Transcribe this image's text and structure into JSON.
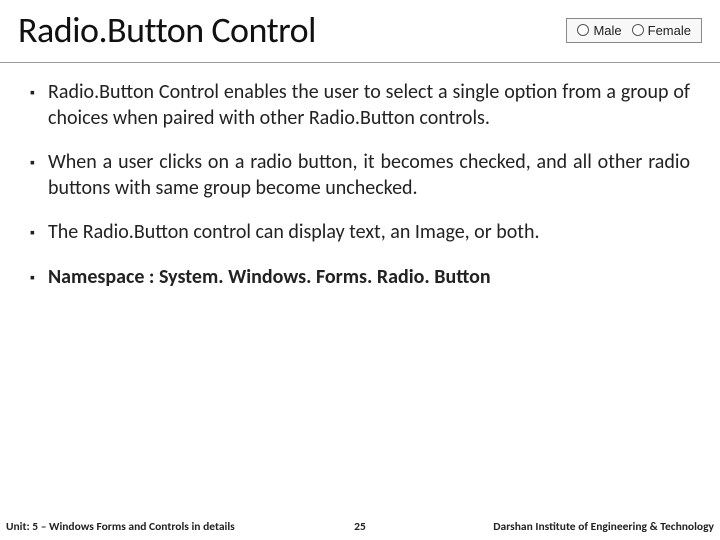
{
  "title": "Radio.Button Control",
  "radio_demo": {
    "option1": "Male",
    "option2": "Female"
  },
  "bullets": [
    {
      "text": "Radio.Button Control enables the user to select a single option from a group of choices when paired with other Radio.Button controls.",
      "justify": true,
      "bold": false,
      "bold_prefix": null
    },
    {
      "text": "When a user clicks on a radio button, it becomes checked, and all other radio buttons with same group become unchecked.",
      "justify": true,
      "bold": false,
      "bold_prefix": null
    },
    {
      "text": "The Radio.Button control can display text, an Image, or both.",
      "justify": false,
      "bold": false,
      "bold_prefix": null
    },
    {
      "text": " : System. Windows. Forms. Radio. Button",
      "justify": false,
      "bold": true,
      "bold_prefix": "Namespace"
    }
  ],
  "footer": {
    "left": "Unit: 5 – Windows Forms and Controls in details",
    "center": "25",
    "right": "Darshan Institute of Engineering & Technology"
  }
}
